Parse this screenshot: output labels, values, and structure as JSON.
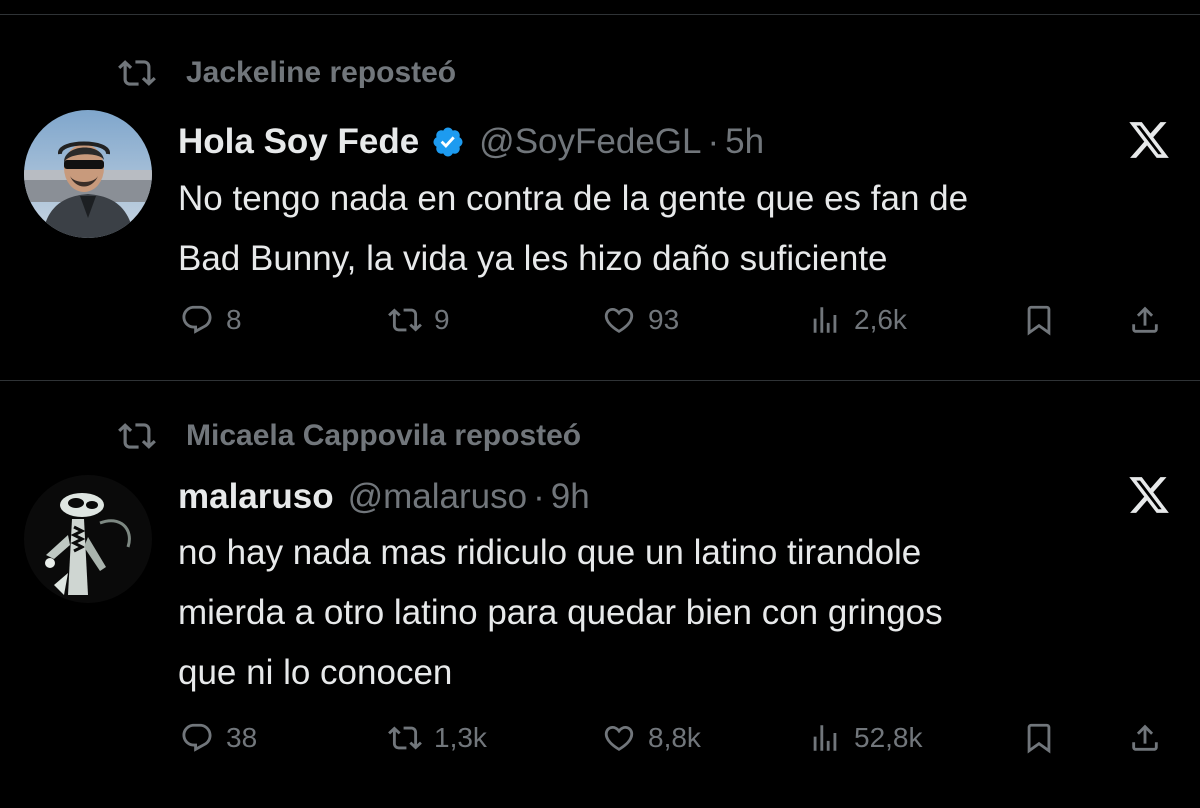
{
  "tweets": [
    {
      "reposted_by": "Jackeline reposteó",
      "name": "Hola Soy Fede",
      "verified": true,
      "handle": "@SoyFedeGL",
      "time": "5h",
      "text_lines": [
        "No tengo nada en contra de la gente que es fan de",
        "Bad Bunny, la vida ya les hizo daño suficiente"
      ],
      "replies": "8",
      "reposts": "9",
      "likes": "93",
      "views": "2,6k"
    },
    {
      "reposted_by": "Micaela Cappovila reposteó",
      "name": "malaruso",
      "verified": false,
      "handle": "@malaruso",
      "time": "9h",
      "text_lines": [
        "no hay nada mas ridiculo que un latino tirandole",
        "mierda a otro latino para quedar bien con gringos",
        "que ni lo conocen"
      ],
      "replies": "38",
      "reposts": "1,3k",
      "likes": "8,8k",
      "views": "52,8k"
    }
  ],
  "separator": "·",
  "icons": [
    "repost-icon",
    "verified-badge-icon",
    "x-logo-icon",
    "reply-icon",
    "like-icon",
    "views-icon",
    "bookmark-icon",
    "share-icon"
  ],
  "colors": {
    "background": "#000000",
    "text": "#e7e9ea",
    "muted": "#71767b",
    "verified": "#1d9bf0",
    "divider": "#2f3336"
  }
}
